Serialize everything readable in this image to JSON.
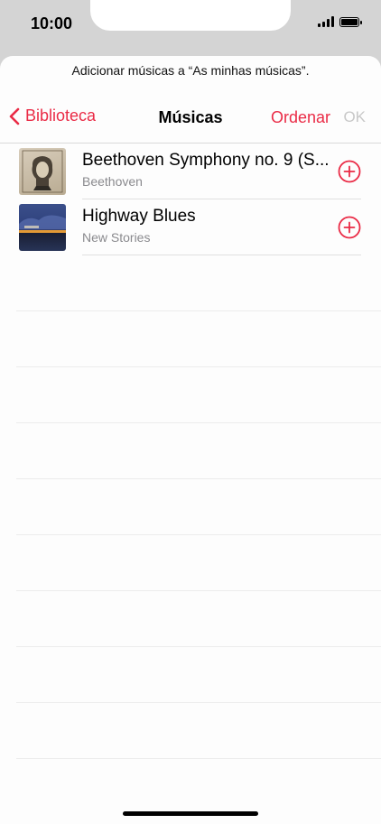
{
  "status": {
    "time": "10:00"
  },
  "sheet": {
    "prompt": "Adicionar músicas a “As minhas músicas”.",
    "nav": {
      "back_label": "Biblioteca",
      "title": "Músicas",
      "sort_label": "Ordenar",
      "ok_label": "OK"
    },
    "songs": [
      {
        "title": "Beethoven Symphony no. 9 (S...",
        "artist": "Beethoven",
        "art": "beethoven-cover"
      },
      {
        "title": "Highway Blues",
        "artist": "New Stories",
        "art": "highway-blues-cover"
      }
    ]
  },
  "colors": {
    "accent": "#ea2b46",
    "disabled": "#c8c8c8",
    "secondary_text": "#8a8a8e"
  }
}
